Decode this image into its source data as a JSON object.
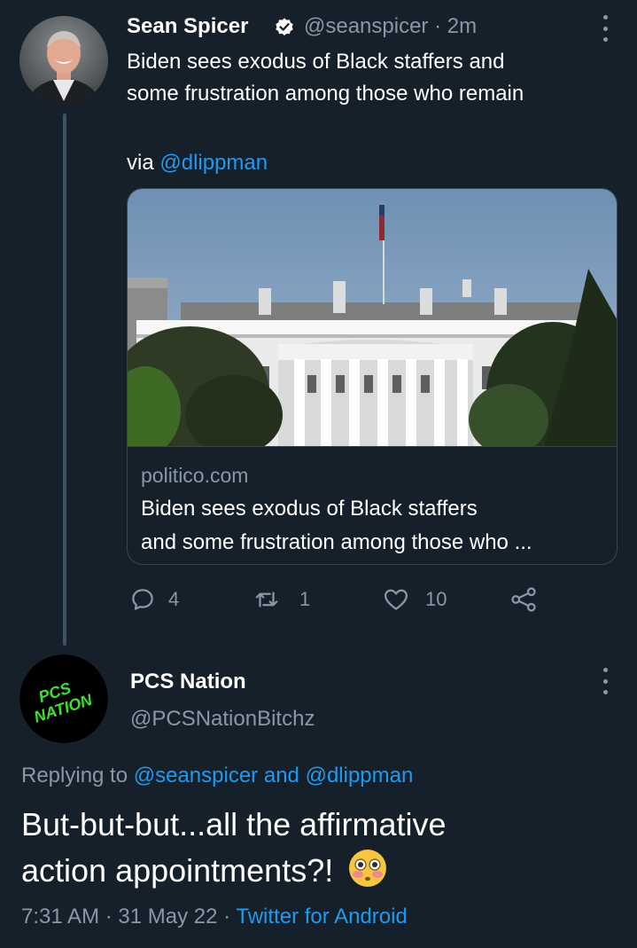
{
  "theme": {
    "background": "#15202b",
    "accent": "#1d9bf0",
    "muted": "#8899a6"
  },
  "tweet": {
    "author_name": "Sean Spicer",
    "verified": true,
    "handle": "@seanspicer",
    "separator": "·",
    "time": "2m",
    "text_line1": "Biden sees exodus of Black staffers and",
    "text_line2": "some frustration among those who remain",
    "via_label": "via",
    "via_mention": "@dlippman",
    "card": {
      "domain": "politico.com",
      "title_line1": "Biden sees exodus of Black staffers",
      "title_line2": "and some frustration among those who ..."
    },
    "actions": {
      "replies": "4",
      "retweets": "1",
      "likes": "10"
    }
  },
  "reply": {
    "author_name": "PCS Nation",
    "handle": "@PCSNationBitchz",
    "avatar_text_line1": "PCS",
    "avatar_text_line2": "NATION",
    "replying_prefix": "Replying to",
    "replying_user1": "@seanspicer",
    "replying_and": "and",
    "replying_user2": "@dlippman",
    "text_line1": "But-but-but...all the affirmative",
    "text_line2": "action appointments?!",
    "emoji": "😳",
    "time": "7:31 AM",
    "dot1": "·",
    "date": "31 May 22",
    "dot2": "·",
    "source": "Twitter for Android"
  }
}
